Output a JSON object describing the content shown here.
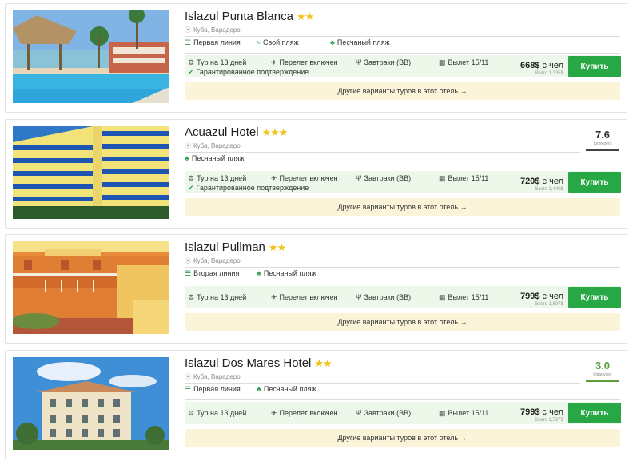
{
  "labels": {
    "other_variants": "Другие варианты туров в этот отель →",
    "buy": "Купить",
    "per_person": "с чел",
    "location_pin": "⦿"
  },
  "icons": {
    "line": "line-icon",
    "beach_own": "swimmer-icon",
    "beach_sand": "palm-icon",
    "days": "gear-icon",
    "flight": "plane-icon",
    "meals": "fork-knife-icon",
    "departure": "calendar-icon",
    "guarantee": "check-circle-icon"
  },
  "colors": {
    "accent": "#28a845",
    "tour_bg": "#edf8ea",
    "variants_bg": "#fbf4d9",
    "star": "#f0c419"
  },
  "hotels": [
    {
      "name": "Islazul Punta Blanca",
      "stars": "★★",
      "location": "Куба, Варадеро",
      "features": [
        "Первая линия",
        "Свой пляж",
        "Песчаный пляж"
      ],
      "tour": {
        "days": "Тур на 13 дней",
        "flight": "Перелет включен",
        "meals": "Завтраки (BB)",
        "departure": "Вылет 15/11",
        "guarantee": "Гарантированное подтверждение"
      },
      "price": "668$",
      "total": "Всего 1,335$"
    },
    {
      "name": "Acuazul Hotel",
      "stars": "★★★",
      "location": "Куба, Варадеро",
      "features": [
        "Песчаный пляж"
      ],
      "tour": {
        "days": "Тур на 13 дней",
        "flight": "Перелет включен",
        "meals": "Завтраки (BB)",
        "departure": "Вылет 15/11",
        "guarantee": "Гарантированное подтверждение"
      },
      "price": "720$",
      "total": "Всего 1,440$",
      "rating": {
        "score": "7.6",
        "source": "turprezent"
      }
    },
    {
      "name": "Islazul Pullman",
      "stars": "★★",
      "location": "Куба, Варадеро",
      "features": [
        "Вторая линия",
        "Песчаный пляж"
      ],
      "tour": {
        "days": "Тур на 13 дней",
        "flight": "Перелет включен",
        "meals": "Завтраки (BB)",
        "departure": "Вылет 15/11"
      },
      "price": "799$",
      "total": "Всего 1,597$"
    },
    {
      "name": "Islazul Dos Mares Hotel",
      "stars": "★★",
      "location": "Куба, Варадеро",
      "features": [
        "Первая линия",
        "Песчаный пляж"
      ],
      "tour": {
        "days": "Тур на 13 дней",
        "flight": "Перелет включен",
        "meals": "Завтраки (BB)",
        "departure": "Вылет 15/11"
      },
      "price": "799$",
      "total": "Всего 1,597$",
      "rating": {
        "score": "3.0",
        "source": "tripadvisor"
      }
    }
  ]
}
